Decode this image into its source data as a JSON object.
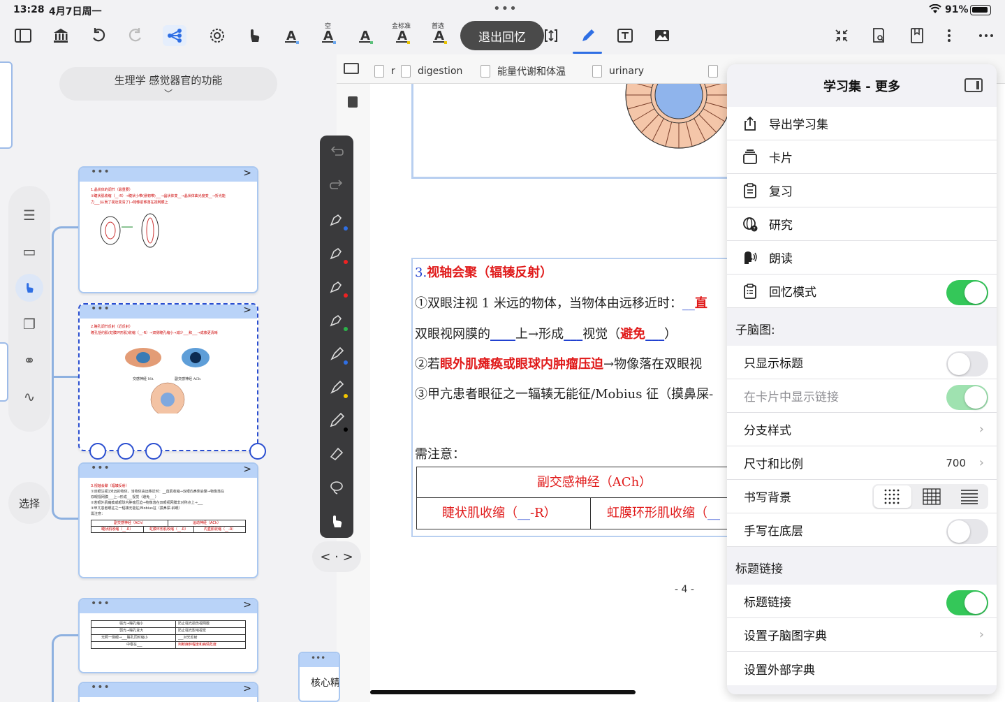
{
  "status": {
    "time": "13:28",
    "date": "4月7日周一",
    "battery": "91%"
  },
  "toolbar": {
    "recall_button": "退出回忆",
    "label_empty": "空",
    "label_gold": "金标准",
    "label_first": "首选"
  },
  "mindmap": {
    "collapse_title": "生理学 感觉器官的功能",
    "select_label": "选择",
    "mini_card_label": "核心精"
  },
  "cards": {
    "c1_lines": [
      "1.晶状体的调节（最重要）",
      "①睫状肌收缩（__-R）→睫状小带(悬韧带)___→晶状体变__→晶状体曲光度变__→折光能",
      "力___(从而了视近变清了)→物像前移落在视网膜上"
    ],
    "c2_lines": [
      "2.瞳孔调节反射（近反射）",
      "瞳孔括约肌(虹膜环形肌)收缩（__-R）→双侧瞳孔缩小→减少___和___→成像更清晰"
    ],
    "c2_labels": [
      "交感神经 NA",
      "副交感神经 ACh"
    ],
    "c3_lines": [
      "3.视轴会聚（辐辏反射）",
      "①双眼注视1米远的物体，当物体由远移近时：__直肌收缩→双眼向鼻侧会聚→物像落在",
      "双眼视网膜___上→形成___视觉（避免___）",
      "②若眼外肌瘫痪或眼球内肿瘤压迫→物像落在双眼视网膜非对称点上→___",
      "③甲亢患者眼征之一辐辏无能征/Mobius征（摸鼻屎-斜眼）",
      "需注意："
    ],
    "c3_table": [
      "副交感神经（ACh）",
      "运动神经（ACh）",
      "睫状肌收缩（__-R）",
      "虹膜环形肌收缩（__-R）",
      "内直肌收缩（__-R）"
    ],
    "c4_rows": [
      [
        "强光→瞳孔缩小",
        "防止强光损伤视网膜"
      ],
      [
        "弱光→瞳孔变大",
        "防止强光影响视觉"
      ],
      [
        "光照一侧眼→___瞳孔同时缩小",
        "___对光反射"
      ],
      [
        "中枢在___",
        "判断麻醉程度和病情危度"
      ]
    ]
  },
  "tabs": [
    {
      "label": "r"
    },
    {
      "label": "digestion"
    },
    {
      "label": "能量代谢和体温"
    },
    {
      "label": "urinary"
    }
  ],
  "doc": {
    "heading_num": "3.",
    "heading_text": "视轴会聚（辐辏反射）",
    "line1": "①双眼注视 1 米远的物体，当物体由远移近时：",
    "line1_blank": "__",
    "line1_red": "直",
    "line2a": "双眼视网膜的",
    "line2_blank1": "____",
    "line2b": "上→形成",
    "line2_blank2": "___",
    "line2c": "视觉（",
    "line2_red": "避免",
    "line2_blank3": "___",
    "line2d": "）",
    "line3a": "②若",
    "line3_red": "眼外肌瘫痪或眼球内肿瘤压迫",
    "line3b": "→物像落在双眼视",
    "line4": "③甲亢患者眼征之一辐辏无能征/Mobius 征（摸鼻屎-",
    "note": "需注意：",
    "table_head": "副交感神经（ACh）",
    "table_c1": "睫状肌收缩（",
    "table_c1_blank": "__",
    "table_c1_tail": "-R）",
    "table_c2": "虹膜环形肌收缩（",
    "table_c2_blank": "__",
    "page_num": "- 4 -"
  },
  "panel": {
    "title": "学习集 - 更多",
    "items": [
      {
        "label": "导出学习集",
        "icon": "share-icon"
      },
      {
        "label": "卡片",
        "icon": "cards-icon"
      },
      {
        "label": "复习",
        "icon": "clipboard-icon"
      },
      {
        "label": "研究",
        "icon": "www-icon"
      },
      {
        "label": "朗读",
        "icon": "speak-icon"
      },
      {
        "label": "回忆模式",
        "icon": "clipboard-list-icon"
      }
    ],
    "recall_mode_on": true,
    "section_submap": "子脑图:",
    "only_title": "只显示标题",
    "only_title_on": false,
    "show_links": "在卡片中显示链接",
    "show_links_on": true,
    "branch_style": "分支样式",
    "size_ratio": "尺寸和比例",
    "size_value": "700",
    "writing_bg": "书写背景",
    "writing_bg_options": [
      "dots",
      "grid",
      "lines"
    ],
    "writing_bg_selected": "dots",
    "handwriting_bottom": "手写在底层",
    "handwriting_bottom_on": false,
    "section_title_link": "标题链接",
    "title_link": "标题链接",
    "title_link_on": true,
    "set_submap_dict": "设置子脑图字典",
    "set_external_dict": "设置外部字典"
  },
  "colors": {
    "accent": "#2f6fe4",
    "toggle_on": "#34c759",
    "doc_red": "#e01a1a",
    "card_header": "#b9d3f8"
  }
}
